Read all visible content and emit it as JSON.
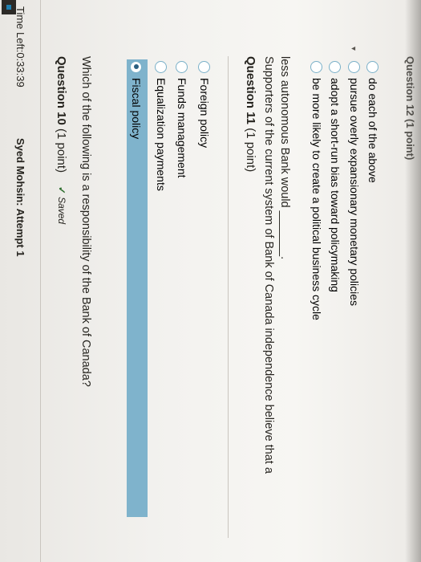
{
  "header": {
    "timer": "Time Left:0:33:39",
    "user": "Syed Mohsin: Attempt 1"
  },
  "question10": {
    "title": "Question 10",
    "points": "(1 point)",
    "saved_label": "Saved",
    "text": "Which of the following is a responsibility of the Bank of Canada?",
    "options": [
      "Fiscal policy",
      "Equalization payments",
      "Funds management",
      "Foreign policy"
    ],
    "selected": "Fiscal policy"
  },
  "question11": {
    "title": "Question 11",
    "points": "(1 point)",
    "text_line1": "Supporters of the current system of Bank of Canada independence believe that a",
    "text_line2": "less autonomous Bank would _______.",
    "options": [
      "be more likely to create a political business cycle",
      "adopt a short-run bias toward policymaking",
      "pursue overly expansionary monetary policies",
      "do each of the above"
    ]
  },
  "question12": {
    "title_partial": "Question 12 (1 point)"
  },
  "colors": {
    "selection_band": "#7fb3cc",
    "radio_border": "#7ab0c8",
    "radio_dot": "#2b5f80",
    "saved_check": "#2f6f2f"
  }
}
